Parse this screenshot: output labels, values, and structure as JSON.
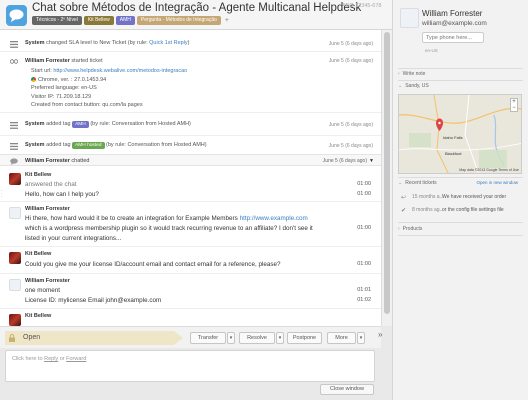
{
  "header": {
    "title": "Chat sobre Métodos de Integração - Agente Multicanal Helpdesk",
    "ticket_id": "ABC-12345-678",
    "tags": {
      "level": "Técnicos - 2º Nível",
      "agent": "Kit Bellew",
      "amh": "AMH",
      "pergunta": "Pergunta - Métodos de Integração"
    },
    "add_tag": "+"
  },
  "feed": {
    "log1": {
      "actor": "System",
      "text": "changed SLA level to New Ticket (by rule: ",
      "rule": "Quick 1st Reply",
      "close": ")",
      "time": "June 5 (6 days ago)"
    },
    "log2": {
      "actor": "William Forrester",
      "text": "started ticket",
      "time": "June 5 (6 days ago)"
    },
    "info": {
      "start_url_label": "Start url:",
      "start_url": "http://www.helpdesk.webalive.com/metodos-integracao",
      "browser": "Chrome, ver. : 27.0.1453.94",
      "language": "Preferred language: en-US",
      "ip": "Visitor IP: 71.209.18.129",
      "created": "Created from contact button: qu.com/la pages"
    },
    "log3": {
      "actor": "System",
      "text": "added tag",
      "badge": "AMH",
      "rule": "(by rule: Conversation from Hosted AMH)",
      "time": "June 5 (6 days ago)"
    },
    "log4": {
      "actor": "System",
      "text": "added tag",
      "badge": "AMH hosted",
      "rule": "(by rule: Conversation from Hosted AMH)",
      "time": "June 5 (6 days ago)"
    },
    "chat_header": {
      "actor": "William Forrester",
      "text": "chatted",
      "time": "June 5 (6 days ago)"
    },
    "messages": [
      {
        "name": "Kit Bellew",
        "lines": [
          "answered the chat",
          "Hello, how can I help you?"
        ],
        "times": [
          "01:00",
          "01:00"
        ]
      },
      {
        "name": "William Forrester",
        "lines": [
          "Hi there, how hard would it be to create an integration for Example Members",
          "which is a wordpress membership plugin so it would track recurring revenue to an affiliate? I don't see it",
          "listed in your current integrations..."
        ],
        "link": "http://www.example.com",
        "times": [
          "01:00"
        ]
      },
      {
        "name": "Kit Bellew",
        "lines": [
          "Could you give me your license ID/account email and contact email for a reference, please?"
        ],
        "times": [
          "01:00"
        ]
      },
      {
        "name": "William Forrester",
        "lines": [
          "one moment",
          "License ID: mylicense Email john@example.com"
        ],
        "times": [
          "01:01",
          "01:02"
        ]
      },
      {
        "name": "Kit Bellew",
        "lines": [],
        "times": []
      }
    ]
  },
  "status_bar": {
    "status": "Open",
    "buttons": {
      "transfer": "Transfer",
      "resolve": "Resolve",
      "postpone": "Postpone",
      "more": "More"
    },
    "dropdown": "▾"
  },
  "reply": {
    "prefix": "Click here to ",
    "reply": "Reply",
    "or": " or ",
    "forward": "Forward"
  },
  "close_window": "Close window",
  "sidebar": {
    "name": "William Forrester",
    "email": "william@example.com",
    "phone_placeholder": "Type phone here...",
    "small": "en-US",
    "write_note": "Write note",
    "location": "Sandy, US",
    "map": {
      "place": "Idaho Falls",
      "place2": "Blackfoot",
      "credits": "Map data ©2013 Google  Terms of Use",
      "plus": "+",
      "minus": "−"
    },
    "recent_tickets": "Recent tickets",
    "open_new_window": "Open in new window",
    "tickets": [
      {
        "when": "15 months a...",
        "what": "We have received your order"
      },
      {
        "when": "8 months ag...",
        "what": "or the config file settings file"
      }
    ],
    "products": "Products"
  },
  "colors": {
    "accent": "#4fa3de",
    "link": "#3a7ec2",
    "open_bg": "#efe6c7"
  }
}
